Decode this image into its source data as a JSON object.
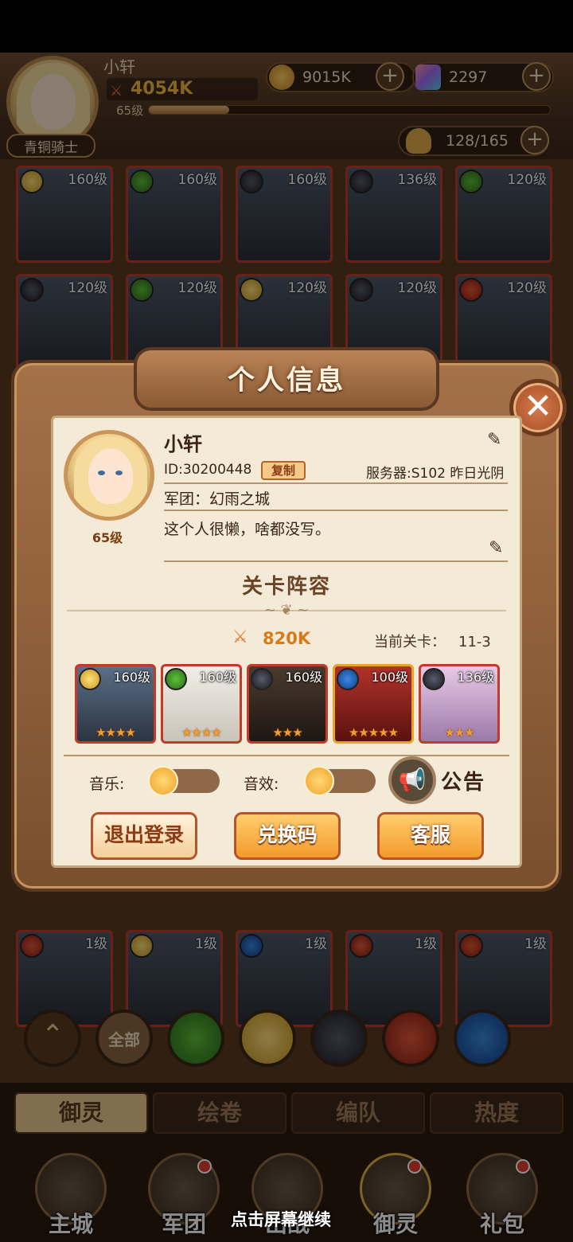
{
  "header": {
    "player_name": "小轩",
    "power": "4054K",
    "level": "65级",
    "rank": "青铜骑士",
    "exp_fraction": 0.2,
    "coins": "9015K",
    "gems": "2297",
    "hero_capacity": "128/165"
  },
  "grid_levels": [
    "160级",
    "160级",
    "160级",
    "136级",
    "120级",
    "120级",
    "120级",
    "120级",
    "120级",
    "120级",
    "1级",
    "1级",
    "1级",
    "1级",
    "1级"
  ],
  "filters": {
    "all": "全部"
  },
  "subtabs": [
    "御灵",
    "绘卷",
    "编队",
    "热度"
  ],
  "nav": [
    "主城",
    "军团",
    "出战",
    "御灵",
    "礼包"
  ],
  "continue_hint": "点击屏幕继续",
  "popup": {
    "title": "个人信息",
    "name": "小轩",
    "id": "ID:30200448",
    "copy": "复制",
    "server": "服务器:S102 昨日光阴",
    "guild": "军团：幻雨之城",
    "signature": "这个人很懒，啥都没写。",
    "level": "65级",
    "lineup_title": "关卡阵容",
    "power": "820K",
    "current_stage_label": "当前关卡：",
    "current_stage": "11-3",
    "lineup": [
      {
        "level": "160级",
        "element": "gold",
        "stars": "★★★★"
      },
      {
        "level": "160级",
        "element": "green",
        "stars": "★★★★"
      },
      {
        "level": "160级",
        "element": "dark",
        "stars": "★★★"
      },
      {
        "level": "100级",
        "element": "blue",
        "stars": "★★★★★"
      },
      {
        "level": "136级",
        "element": "dark",
        "stars": "★★★"
      }
    ],
    "music_label": "音乐:",
    "sfx_label": "音效:",
    "notice_label": "公告",
    "buttons": {
      "logout": "退出登录",
      "redeem": "兑换码",
      "service": "客服"
    }
  },
  "colors": {
    "accent": "#f29a2c",
    "frame": "#7a4f2e",
    "paper": "#f3ead8",
    "card_border": "#c23a2a"
  }
}
